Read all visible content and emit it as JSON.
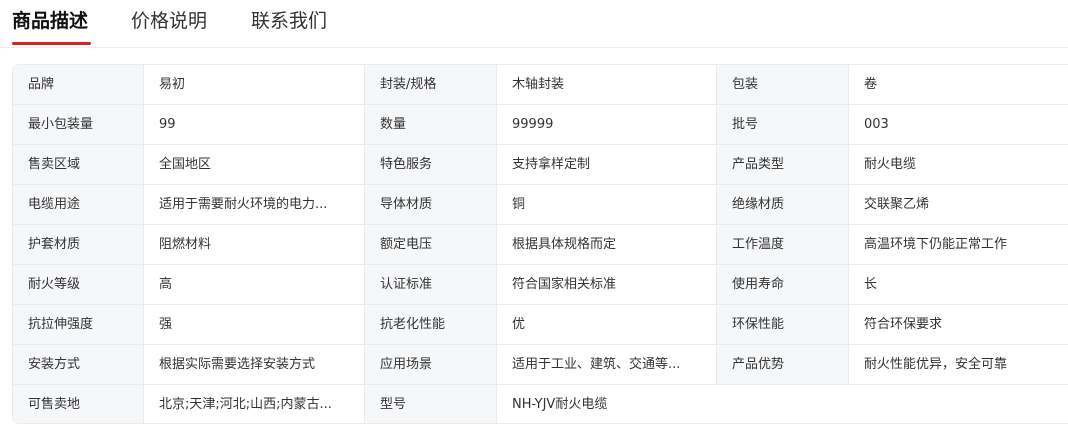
{
  "tabs": [
    {
      "label": "商品描述",
      "active": true
    },
    {
      "label": "价格说明",
      "active": false
    },
    {
      "label": "联系我们",
      "active": false
    }
  ],
  "accent_color": "#e02020",
  "specs": [
    [
      [
        "品牌",
        "易初"
      ],
      [
        "封装/规格",
        "木轴封装"
      ],
      [
        "包装",
        "卷"
      ]
    ],
    [
      [
        "最小包装量",
        "99"
      ],
      [
        "数量",
        "99999"
      ],
      [
        "批号",
        "003"
      ]
    ],
    [
      [
        "售卖区域",
        "全国地区"
      ],
      [
        "特色服务",
        "支持拿样定制"
      ],
      [
        "产品类型",
        "耐火电缆"
      ]
    ],
    [
      [
        "电缆用途",
        "适用于需要耐火环境的电力..."
      ],
      [
        "导体材质",
        "铜"
      ],
      [
        "绝缘材质",
        "交联聚乙烯"
      ]
    ],
    [
      [
        "护套材质",
        "阻燃材料"
      ],
      [
        "额定电压",
        "根据具体规格而定"
      ],
      [
        "工作温度",
        "高温环境下仍能正常工作"
      ]
    ],
    [
      [
        "耐火等级",
        "高"
      ],
      [
        "认证标准",
        "符合国家相关标准"
      ],
      [
        "使用寿命",
        "长"
      ]
    ],
    [
      [
        "抗拉伸强度",
        "强"
      ],
      [
        "抗老化性能",
        "优"
      ],
      [
        "环保性能",
        "符合环保要求"
      ]
    ],
    [
      [
        "安装方式",
        "根据实际需要选择安装方式"
      ],
      [
        "应用场景",
        "适用于工业、建筑、交通等..."
      ],
      [
        "产品优势",
        "耐火性能优异，安全可靠"
      ]
    ],
    [
      [
        "可售卖地",
        "北京;天津;河北;山西;内蒙古..."
      ],
      [
        "型号",
        "NH-YJV耐火电缆"
      ]
    ]
  ]
}
